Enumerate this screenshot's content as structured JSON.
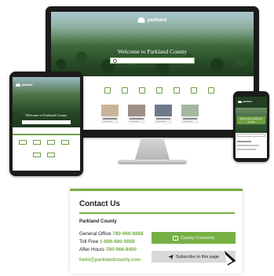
{
  "desktop": {
    "brand": "parkland",
    "hero_title": "Welcome to Parkland County"
  },
  "tablet": {
    "brand": "parkland",
    "hero_title": "Welcome to Parkland County"
  },
  "phone": {
    "brand": "parkland",
    "hero_title": "Welcome to Parkland County"
  },
  "contact": {
    "title": "Contact Us",
    "org": "Parkland County",
    "general_label": "General Office",
    "general_number": "780-968-8888",
    "tollfree_label": "Toll Free",
    "tollfree_number": "1-888-880-0858",
    "afterhours_label": "After Hours",
    "afterhours_number": "780-968-8400",
    "email": "hello@parklandcounty.com",
    "concern_button": "County Concerns",
    "subscribe_button": "Subscribe to this page"
  },
  "colors": {
    "accent": "#76b043",
    "dark": "#1b1b1b"
  }
}
